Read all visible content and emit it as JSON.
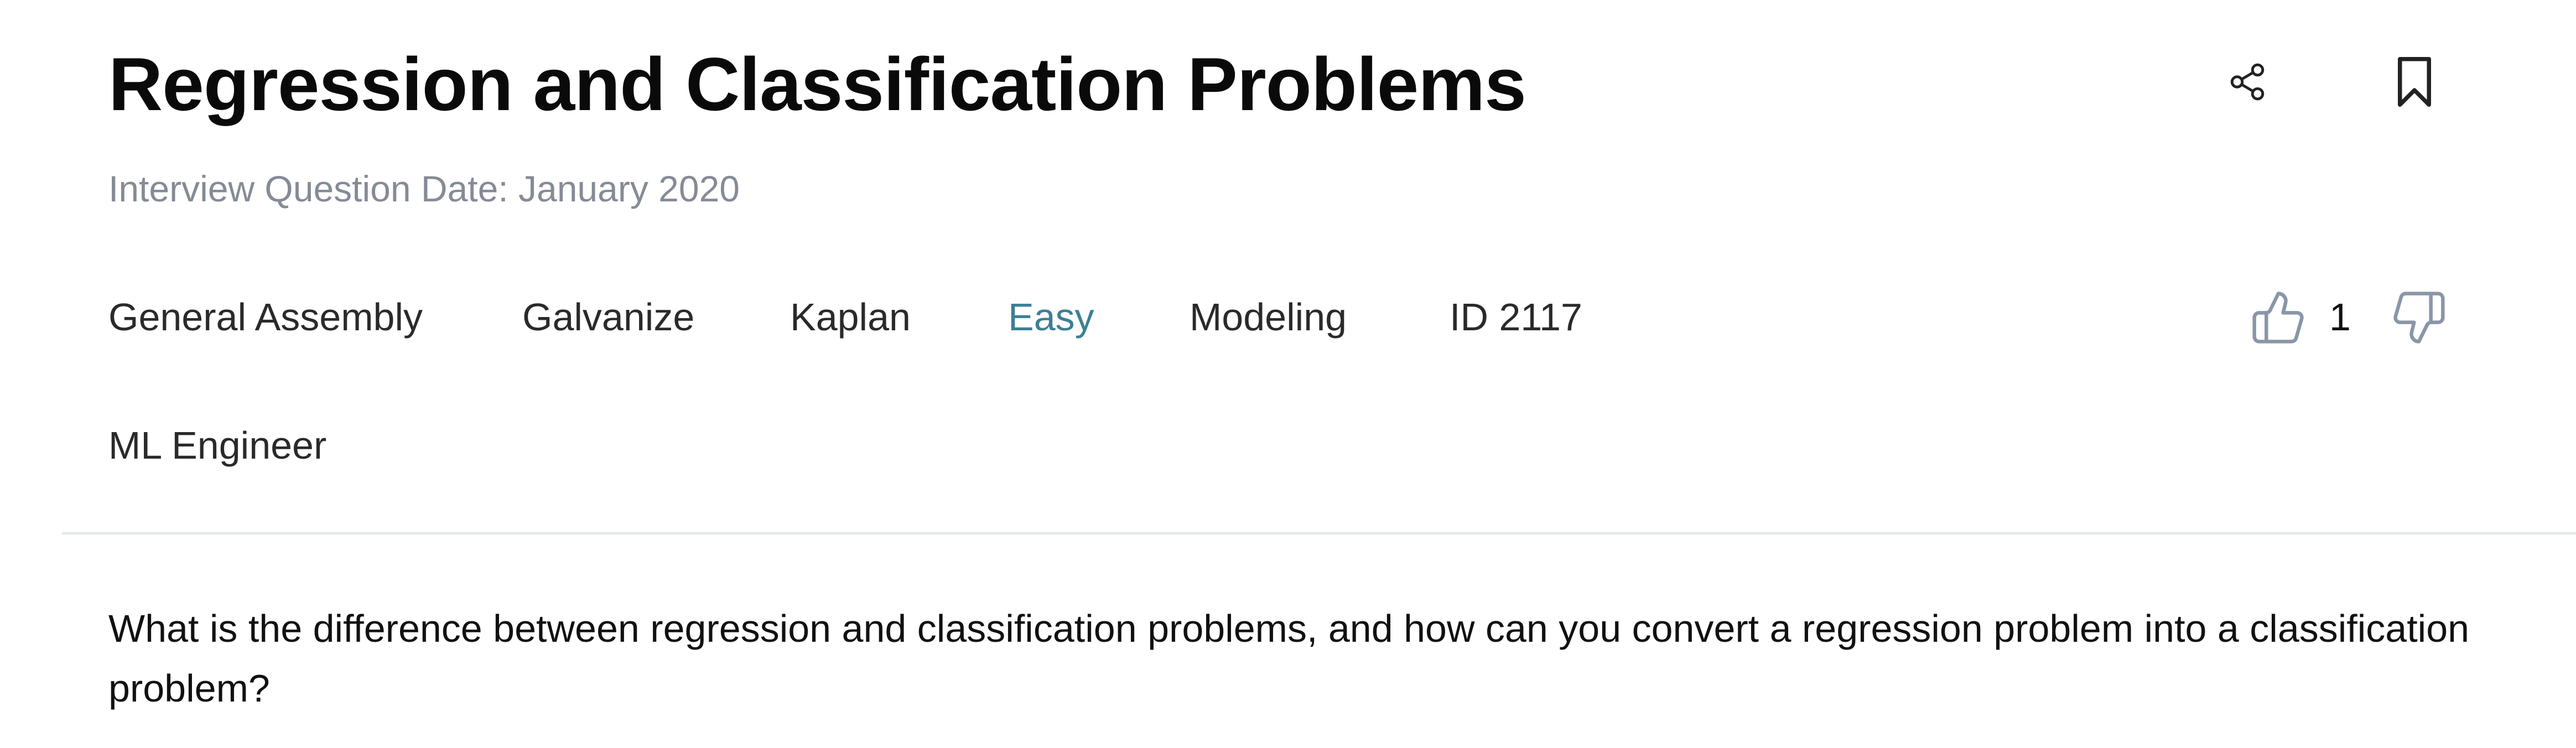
{
  "header": {
    "title": "Regression and Classification Problems",
    "date_label": "Interview Question Date: January 2020"
  },
  "actions": {
    "share_icon": "share-icon",
    "bookmark_icon": "bookmark-icon"
  },
  "tags": {
    "companies": [
      "General Assembly",
      "Galvanize",
      "Kaplan"
    ],
    "difficulty": "Easy",
    "category": "Modeling",
    "id_label": "ID 2117",
    "role": "ML Engineer"
  },
  "votes": {
    "up_icon": "thumbs-up-icon",
    "count": "1",
    "down_icon": "thumbs-down-icon"
  },
  "question": {
    "text": "What is the difference between regression and classification problems, and how can you convert a regression problem into a classification problem?"
  },
  "colors": {
    "difficulty_easy": "#3d7f94",
    "icon_gray": "#8a96a8",
    "muted_text": "#858b96",
    "divider": "#e4e6ea"
  }
}
